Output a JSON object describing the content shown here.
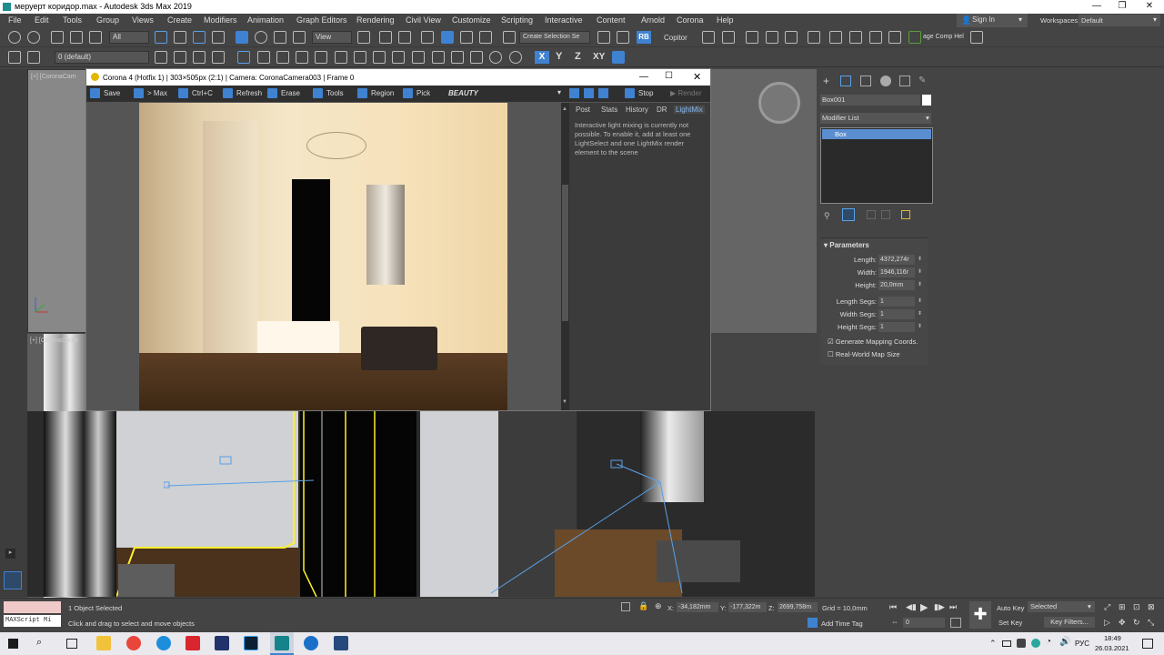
{
  "window": {
    "title": "меруерт коридор.max - Autodesk 3ds Max 2019"
  },
  "menu": [
    "File",
    "Edit",
    "Tools",
    "Group",
    "Views",
    "Create",
    "Modifiers",
    "Animation",
    "Graph Editors",
    "Rendering",
    "Civil View",
    "Customize",
    "Scripting",
    "Interactive",
    "Content",
    "Arnold",
    "Corona",
    "Help"
  ],
  "account": {
    "signin": "Sign In",
    "workspaces_label": "Workspaces:",
    "workspace": "Default"
  },
  "toolbar": {
    "filter": "All",
    "ref_coord": "View",
    "selection_set": "Create Selection Se",
    "rb": "RB",
    "copitor": "Copitor",
    "comp_label": "age Comp Hel",
    "layer": "0 (default)",
    "axes": [
      "X",
      "Y",
      "Z",
      "XY"
    ]
  },
  "viewports": {
    "top_left_label": "[+] [CoronaCam",
    "mid_left_label": "[+] [CoronaCame"
  },
  "render_window": {
    "title": "Corona 4 (Hotfix 1) | 303×505px (2:1) | Camera: CoronaCamera003 | Frame 0",
    "buttons": [
      "Save",
      "> Max",
      "Ctrl+C",
      "Refresh",
      "Erase",
      "Tools",
      "Region",
      "Pick"
    ],
    "channel": "BEAUTY",
    "stop": "Stop",
    "render": "Render",
    "tabs": [
      "Post",
      "Stats",
      "History",
      "DR",
      "LightMix"
    ],
    "active_tab": "LightMix",
    "lightmix_message": "Interactive light mixing is currently not possible. To enable it, add at least one LightSelect and one LightMix render element to the scene"
  },
  "command_panel": {
    "object_name": "Box001",
    "object_color": "#ffffff",
    "modifier_list_label": "Modifier List",
    "stack": [
      "Box"
    ],
    "rollout_title": "Parameters",
    "params": [
      {
        "label": "Length:",
        "value": "4372,274r"
      },
      {
        "label": "Width:",
        "value": "1946,116r"
      },
      {
        "label": "Height:",
        "value": "20,0mm"
      },
      {
        "label": "Length Segs:",
        "value": "1"
      },
      {
        "label": "Width Segs:",
        "value": "1"
      },
      {
        "label": "Height Segs:",
        "value": "1"
      }
    ],
    "gen_mapping": "Generate Mapping Coords.",
    "real_world": "Real-World Map Size"
  },
  "status": {
    "maxscript": "MAXScript Mi",
    "objects_selected": "1 Object Selected",
    "prompt": "Click and drag to select and move objects",
    "x_label": "X:",
    "x": "-34,182mm",
    "y_label": "Y:",
    "y": "-177,322m",
    "z_label": "Z:",
    "z": "2699,758m",
    "grid": "Grid = 10,0mm",
    "add_time_tag": "Add Time Tag",
    "frame": "0",
    "auto_key": "Auto Key",
    "set_key": "Set Key",
    "selected": "Selected",
    "key_filters": "Key Filters..."
  },
  "taskbar": {
    "lang": "РУС",
    "time": "18:49",
    "date": "26.03.2021"
  },
  "colors": {
    "accent": "#3f82d1",
    "bg": "#444444"
  }
}
